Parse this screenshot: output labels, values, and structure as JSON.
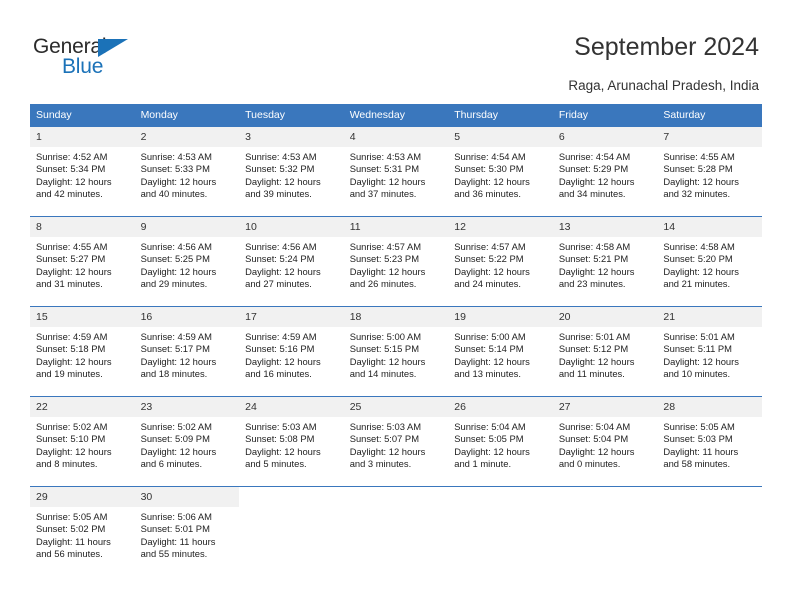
{
  "brand": {
    "name_part1": "General",
    "name_part2": "Blue",
    "triangle_color": "#1b72b8"
  },
  "header": {
    "title": "September 2024",
    "subtitle": "Raga, Arunachal Pradesh, India",
    "accent_color": "#3a77bd",
    "daynum_background": "#f1f1f1"
  },
  "calendar": {
    "weekday_headers": [
      "Sunday",
      "Monday",
      "Tuesday",
      "Wednesday",
      "Thursday",
      "Friday",
      "Saturday"
    ],
    "weeks": [
      [
        {
          "day": "1",
          "sunrise": "Sunrise: 4:52 AM",
          "sunset": "Sunset: 5:34 PM",
          "daylight_line1": "Daylight: 12 hours",
          "daylight_line2": "and 42 minutes."
        },
        {
          "day": "2",
          "sunrise": "Sunrise: 4:53 AM",
          "sunset": "Sunset: 5:33 PM",
          "daylight_line1": "Daylight: 12 hours",
          "daylight_line2": "and 40 minutes."
        },
        {
          "day": "3",
          "sunrise": "Sunrise: 4:53 AM",
          "sunset": "Sunset: 5:32 PM",
          "daylight_line1": "Daylight: 12 hours",
          "daylight_line2": "and 39 minutes."
        },
        {
          "day": "4",
          "sunrise": "Sunrise: 4:53 AM",
          "sunset": "Sunset: 5:31 PM",
          "daylight_line1": "Daylight: 12 hours",
          "daylight_line2": "and 37 minutes."
        },
        {
          "day": "5",
          "sunrise": "Sunrise: 4:54 AM",
          "sunset": "Sunset: 5:30 PM",
          "daylight_line1": "Daylight: 12 hours",
          "daylight_line2": "and 36 minutes."
        },
        {
          "day": "6",
          "sunrise": "Sunrise: 4:54 AM",
          "sunset": "Sunset: 5:29 PM",
          "daylight_line1": "Daylight: 12 hours",
          "daylight_line2": "and 34 minutes."
        },
        {
          "day": "7",
          "sunrise": "Sunrise: 4:55 AM",
          "sunset": "Sunset: 5:28 PM",
          "daylight_line1": "Daylight: 12 hours",
          "daylight_line2": "and 32 minutes."
        }
      ],
      [
        {
          "day": "8",
          "sunrise": "Sunrise: 4:55 AM",
          "sunset": "Sunset: 5:27 PM",
          "daylight_line1": "Daylight: 12 hours",
          "daylight_line2": "and 31 minutes."
        },
        {
          "day": "9",
          "sunrise": "Sunrise: 4:56 AM",
          "sunset": "Sunset: 5:25 PM",
          "daylight_line1": "Daylight: 12 hours",
          "daylight_line2": "and 29 minutes."
        },
        {
          "day": "10",
          "sunrise": "Sunrise: 4:56 AM",
          "sunset": "Sunset: 5:24 PM",
          "daylight_line1": "Daylight: 12 hours",
          "daylight_line2": "and 27 minutes."
        },
        {
          "day": "11",
          "sunrise": "Sunrise: 4:57 AM",
          "sunset": "Sunset: 5:23 PM",
          "daylight_line1": "Daylight: 12 hours",
          "daylight_line2": "and 26 minutes."
        },
        {
          "day": "12",
          "sunrise": "Sunrise: 4:57 AM",
          "sunset": "Sunset: 5:22 PM",
          "daylight_line1": "Daylight: 12 hours",
          "daylight_line2": "and 24 minutes."
        },
        {
          "day": "13",
          "sunrise": "Sunrise: 4:58 AM",
          "sunset": "Sunset: 5:21 PM",
          "daylight_line1": "Daylight: 12 hours",
          "daylight_line2": "and 23 minutes."
        },
        {
          "day": "14",
          "sunrise": "Sunrise: 4:58 AM",
          "sunset": "Sunset: 5:20 PM",
          "daylight_line1": "Daylight: 12 hours",
          "daylight_line2": "and 21 minutes."
        }
      ],
      [
        {
          "day": "15",
          "sunrise": "Sunrise: 4:59 AM",
          "sunset": "Sunset: 5:18 PM",
          "daylight_line1": "Daylight: 12 hours",
          "daylight_line2": "and 19 minutes."
        },
        {
          "day": "16",
          "sunrise": "Sunrise: 4:59 AM",
          "sunset": "Sunset: 5:17 PM",
          "daylight_line1": "Daylight: 12 hours",
          "daylight_line2": "and 18 minutes."
        },
        {
          "day": "17",
          "sunrise": "Sunrise: 4:59 AM",
          "sunset": "Sunset: 5:16 PM",
          "daylight_line1": "Daylight: 12 hours",
          "daylight_line2": "and 16 minutes."
        },
        {
          "day": "18",
          "sunrise": "Sunrise: 5:00 AM",
          "sunset": "Sunset: 5:15 PM",
          "daylight_line1": "Daylight: 12 hours",
          "daylight_line2": "and 14 minutes."
        },
        {
          "day": "19",
          "sunrise": "Sunrise: 5:00 AM",
          "sunset": "Sunset: 5:14 PM",
          "daylight_line1": "Daylight: 12 hours",
          "daylight_line2": "and 13 minutes."
        },
        {
          "day": "20",
          "sunrise": "Sunrise: 5:01 AM",
          "sunset": "Sunset: 5:12 PM",
          "daylight_line1": "Daylight: 12 hours",
          "daylight_line2": "and 11 minutes."
        },
        {
          "day": "21",
          "sunrise": "Sunrise: 5:01 AM",
          "sunset": "Sunset: 5:11 PM",
          "daylight_line1": "Daylight: 12 hours",
          "daylight_line2": "and 10 minutes."
        }
      ],
      [
        {
          "day": "22",
          "sunrise": "Sunrise: 5:02 AM",
          "sunset": "Sunset: 5:10 PM",
          "daylight_line1": "Daylight: 12 hours",
          "daylight_line2": "and 8 minutes."
        },
        {
          "day": "23",
          "sunrise": "Sunrise: 5:02 AM",
          "sunset": "Sunset: 5:09 PM",
          "daylight_line1": "Daylight: 12 hours",
          "daylight_line2": "and 6 minutes."
        },
        {
          "day": "24",
          "sunrise": "Sunrise: 5:03 AM",
          "sunset": "Sunset: 5:08 PM",
          "daylight_line1": "Daylight: 12 hours",
          "daylight_line2": "and 5 minutes."
        },
        {
          "day": "25",
          "sunrise": "Sunrise: 5:03 AM",
          "sunset": "Sunset: 5:07 PM",
          "daylight_line1": "Daylight: 12 hours",
          "daylight_line2": "and 3 minutes."
        },
        {
          "day": "26",
          "sunrise": "Sunrise: 5:04 AM",
          "sunset": "Sunset: 5:05 PM",
          "daylight_line1": "Daylight: 12 hours",
          "daylight_line2": "and 1 minute."
        },
        {
          "day": "27",
          "sunrise": "Sunrise: 5:04 AM",
          "sunset": "Sunset: 5:04 PM",
          "daylight_line1": "Daylight: 12 hours",
          "daylight_line2": "and 0 minutes."
        },
        {
          "day": "28",
          "sunrise": "Sunrise: 5:05 AM",
          "sunset": "Sunset: 5:03 PM",
          "daylight_line1": "Daylight: 11 hours",
          "daylight_line2": "and 58 minutes."
        }
      ],
      [
        {
          "day": "29",
          "sunrise": "Sunrise: 5:05 AM",
          "sunset": "Sunset: 5:02 PM",
          "daylight_line1": "Daylight: 11 hours",
          "daylight_line2": "and 56 minutes."
        },
        {
          "day": "30",
          "sunrise": "Sunrise: 5:06 AM",
          "sunset": "Sunset: 5:01 PM",
          "daylight_line1": "Daylight: 11 hours",
          "daylight_line2": "and 55 minutes."
        },
        {
          "day": "",
          "sunrise": "",
          "sunset": "",
          "daylight_line1": "",
          "daylight_line2": ""
        },
        {
          "day": "",
          "sunrise": "",
          "sunset": "",
          "daylight_line1": "",
          "daylight_line2": ""
        },
        {
          "day": "",
          "sunrise": "",
          "sunset": "",
          "daylight_line1": "",
          "daylight_line2": ""
        },
        {
          "day": "",
          "sunrise": "",
          "sunset": "",
          "daylight_line1": "",
          "daylight_line2": ""
        },
        {
          "day": "",
          "sunrise": "",
          "sunset": "",
          "daylight_line1": "",
          "daylight_line2": ""
        }
      ]
    ]
  }
}
